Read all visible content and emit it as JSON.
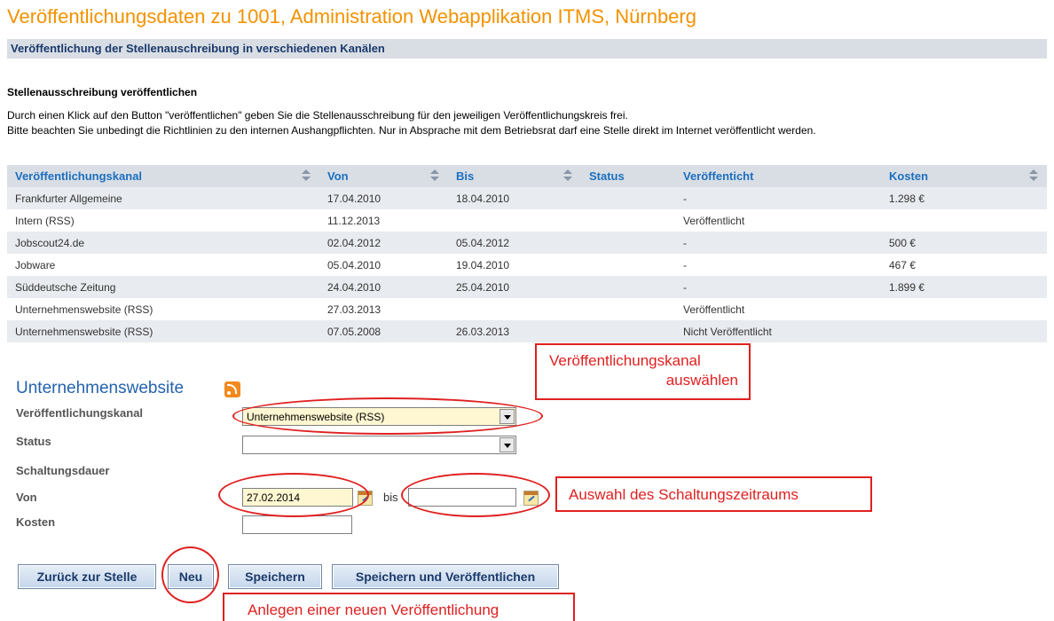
{
  "header": {
    "title": "Veröffentlichungsdaten zu 1001, Administration Webapplikation ITMS, Nürnberg",
    "subtitle": "Veröffentlichung der Stellenauschreibung in verschiedenen Kanälen"
  },
  "intro": {
    "heading": "Stellenausschreibung veröffentlichen",
    "line1": "Durch einen Klick auf den Button \"veröffentlichen\" geben Sie die Stellenausschreibung für den jeweiligen Veröffentlichungskreis frei.",
    "line2": "Bitte beachten Sie unbedingt die Richtlinien zu den internen Aushangpflichten. Nur in Absprache mit dem Betriebsrat darf eine Stelle direkt im Internet veröffentlicht werden."
  },
  "table": {
    "columns": [
      {
        "label": "Veröffentlichungskanal",
        "sortable": true
      },
      {
        "label": "Von",
        "sortable": true
      },
      {
        "label": "Bis",
        "sortable": true
      },
      {
        "label": "Status",
        "sortable": false
      },
      {
        "label": "Veröffenticht",
        "sortable": false
      },
      {
        "label": "Kosten",
        "sortable": true
      }
    ],
    "rows": [
      [
        "Frankfurter Allgemeine",
        "17.04.2010",
        "18.04.2010",
        "",
        "-",
        "1.298 €"
      ],
      [
        "Intern (RSS)",
        "11.12.2013",
        "",
        "",
        "Veröffentlicht",
        ""
      ],
      [
        "Jobscout24.de",
        "02.04.2012",
        "05.04.2012",
        "",
        "-",
        "500 €"
      ],
      [
        "Jobware",
        "05.04.2010",
        "19.04.2010",
        "",
        "-",
        "467 €"
      ],
      [
        "Süddeutsche Zeitung",
        "24.04.2010",
        "25.04.2010",
        "",
        "-",
        "1.899 €"
      ],
      [
        "Unternehmenswebsite (RSS)",
        "27.03.2013",
        "",
        "",
        "Veröffentlicht",
        ""
      ],
      [
        "Unternehmenswebsite (RSS)",
        "07.05.2008",
        "26.03.2013",
        "",
        "Nicht Veröffentlicht",
        ""
      ]
    ]
  },
  "form": {
    "title": "Unternehmenswebsite",
    "title_icon": "rss-icon",
    "channel_label": "Veröffentlichungskanal",
    "channel_value": "Unternehmenswebsite (RSS)",
    "status_label": "Status",
    "status_value": "",
    "duration_label": "Schaltungsdauer",
    "from_label": "Von",
    "from_value": "27.02.2014",
    "to_label": "bis",
    "to_value": "",
    "cost_label": "Kosten",
    "cost_value": ""
  },
  "buttons": {
    "back": "Zurück zur Stelle",
    "new": "Neu",
    "save": "Speichern",
    "save_publish": "Speichern und Veröffentlichen"
  },
  "annotations": {
    "channel_callout_line1": "Veröffentlichungskanal",
    "channel_callout_line2": "auswählen",
    "period_callout": "Auswahl des Schaltungszeitraums",
    "new_callout": "Anlegen einer neuen Veröffentlichung"
  },
  "colors": {
    "title": "#f39200",
    "header_bar": "#d9dee5",
    "link_blue": "#1c6fbf",
    "annotation_red": "#e02020",
    "input_highlight": "#fff7d1"
  }
}
